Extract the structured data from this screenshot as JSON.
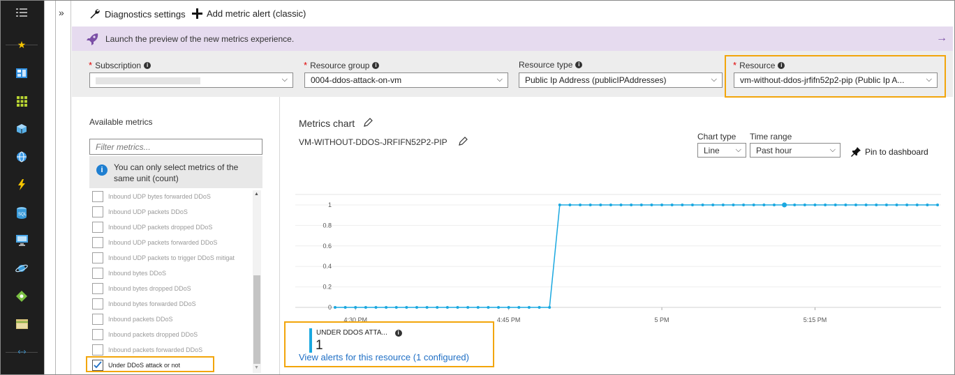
{
  "sidebar": {
    "expand_icon": "list-icon",
    "items": [
      {
        "icon": "favorites-star-icon",
        "color": "#f5c400"
      },
      {
        "icon": "dashboard-icon",
        "color": "#2f8fe0"
      },
      {
        "icon": "all-resources-grid-icon",
        "color": "#b8d432"
      },
      {
        "icon": "resource-group-cube-icon",
        "color": "#58b0e8"
      },
      {
        "icon": "app-service-globe-icon",
        "color": "#3f9de8"
      },
      {
        "icon": "function-app-bolt-icon",
        "color": "#f5c400"
      },
      {
        "icon": "sql-database-icon",
        "color": "#3a9bd9"
      },
      {
        "icon": "virtual-machine-monitor-icon",
        "color": "#4aa7e8"
      },
      {
        "icon": "cosmos-db-planet-icon",
        "color": "#3a9bd9"
      },
      {
        "icon": "load-balancer-icon",
        "color": "#7bc143"
      },
      {
        "icon": "storage-account-icon",
        "color": "#d7c27a"
      },
      {
        "icon": "virtual-network-icon",
        "color": "#44b6ff"
      }
    ]
  },
  "toolbar": {
    "diagnostics_label": "Diagnostics settings",
    "add_alert_label": "Add metric alert (classic)"
  },
  "banner": {
    "text": "Launch the preview of the new metrics experience."
  },
  "filters": {
    "subscription_label": "Subscription",
    "subscription_value": "",
    "resource_group_label": "Resource group",
    "resource_group_value": "0004-ddos-attack-on-vm",
    "resource_type_label": "Resource type",
    "resource_type_value": "Public Ip Address (publicIPAddresses)",
    "resource_label": "Resource",
    "resource_value": "vm-without-ddos-jrfifn52p2-pip (Public Ip A..."
  },
  "metrics_panel": {
    "title": "Available metrics",
    "filter_placeholder": "Filter metrics...",
    "unit_info": "You can only select metrics of the same unit (count)",
    "items": [
      {
        "label": "Inbound UDP bytes forwarded DDoS",
        "checked": false
      },
      {
        "label": "Inbound UDP packets DDoS",
        "checked": false
      },
      {
        "label": "Inbound UDP packets dropped DDoS",
        "checked": false
      },
      {
        "label": "Inbound UDP packets forwarded DDoS",
        "checked": false
      },
      {
        "label": "Inbound UDP packets to trigger DDoS mitigat",
        "checked": false
      },
      {
        "label": "Inbound bytes DDoS",
        "checked": false
      },
      {
        "label": "Inbound bytes dropped DDoS",
        "checked": false
      },
      {
        "label": "Inbound bytes forwarded DDoS",
        "checked": false
      },
      {
        "label": "Inbound packets DDoS",
        "checked": false
      },
      {
        "label": "Inbound packets dropped DDoS",
        "checked": false
      },
      {
        "label": "Inbound packets forwarded DDoS",
        "checked": false
      },
      {
        "label": "Under DDoS attack or not",
        "checked": true
      }
    ]
  },
  "chart_panel": {
    "title": "Metrics chart",
    "resource_name": "VM-WITHOUT-DDOS-JRFIFN52P2-PIP",
    "chart_type_label": "Chart type",
    "chart_type_value": "Line",
    "time_range_label": "Time range",
    "time_range_value": "Past hour",
    "pin_label": "Pin to dashboard",
    "legend_name": "UNDER DDOS ATTA...",
    "legend_value": "1",
    "alerts_link": "View alerts for this resource (1 configured)"
  },
  "colors": {
    "series": "#1aa8e0",
    "highlight": "#f2a50a",
    "banner_bg": "#e6dbef",
    "link": "#1f6fc5"
  },
  "chart_data": {
    "type": "line",
    "title": "",
    "xlabel": "",
    "ylabel": "",
    "ylim": [
      0,
      1
    ],
    "yticks": [
      "1",
      "0.8",
      "0.6",
      "0.4",
      "0.2",
      "0"
    ],
    "xticks": [
      "4:30 PM",
      "4:45 PM",
      "5 PM",
      "5:15 PM"
    ],
    "series": [
      {
        "name": "UNDER DDOS ATTA...",
        "x_minutes_after_4_28": [
          0,
          1,
          2,
          3,
          4,
          5,
          6,
          7,
          8,
          9,
          10,
          11,
          12,
          13,
          14,
          15,
          16,
          17,
          18,
          19,
          20,
          21,
          22,
          23,
          24,
          25,
          26,
          27,
          28,
          29,
          30,
          31,
          32,
          33,
          34,
          35,
          36,
          37,
          38,
          39,
          40,
          41,
          42,
          43,
          44,
          45,
          46,
          47,
          48,
          49,
          50,
          51,
          52,
          53,
          54,
          55,
          56,
          57,
          58,
          59
        ],
        "values": [
          0,
          0,
          0,
          0,
          0,
          0,
          0,
          0,
          0,
          0,
          0,
          0,
          0,
          0,
          0,
          0,
          0,
          0,
          0,
          0,
          0,
          0,
          1,
          1,
          1,
          1,
          1,
          1,
          1,
          1,
          1,
          1,
          1,
          1,
          1,
          1,
          1,
          1,
          1,
          1,
          1,
          1,
          1,
          1,
          1,
          1,
          1,
          1,
          1,
          1,
          1,
          1,
          1,
          1,
          1,
          1,
          1,
          1,
          1,
          1
        ]
      }
    ]
  }
}
